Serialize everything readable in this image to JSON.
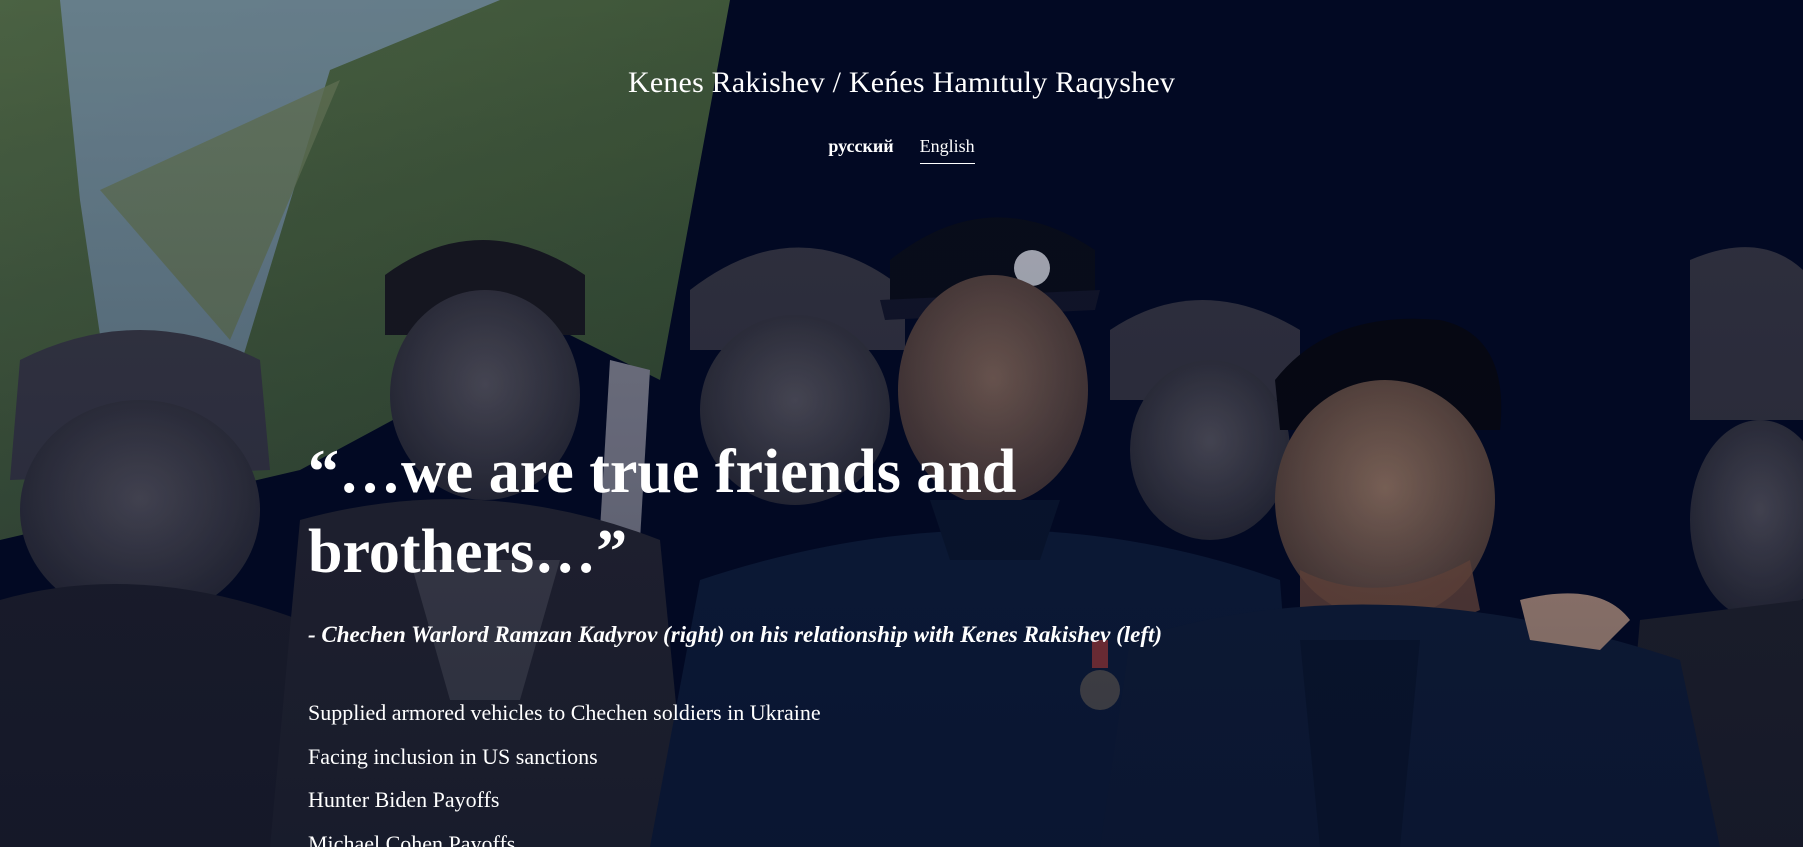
{
  "header": {
    "title": "Kenes Rakishev / Keńes Hamıtuly Raqyshev"
  },
  "lang_nav": {
    "items": [
      {
        "label": "русский",
        "active": false
      },
      {
        "label": "English",
        "active": true
      }
    ]
  },
  "hero": {
    "quote_line1": "“…we are true friends and",
    "quote_line2": "brothers…”",
    "attribution": "- Chechen Warlord Ramzan Kadyrov (right) on his relationship with Kenes Rakishev (left)",
    "points": [
      "Supplied armored vehicles to Chechen soldiers in Ukraine",
      "Facing inclusion in US sanctions",
      "Hunter Biden Payoffs",
      "Michael Cohen Payoffs"
    ]
  },
  "colors": {
    "background": "#030a24",
    "text": "#ffffff"
  }
}
